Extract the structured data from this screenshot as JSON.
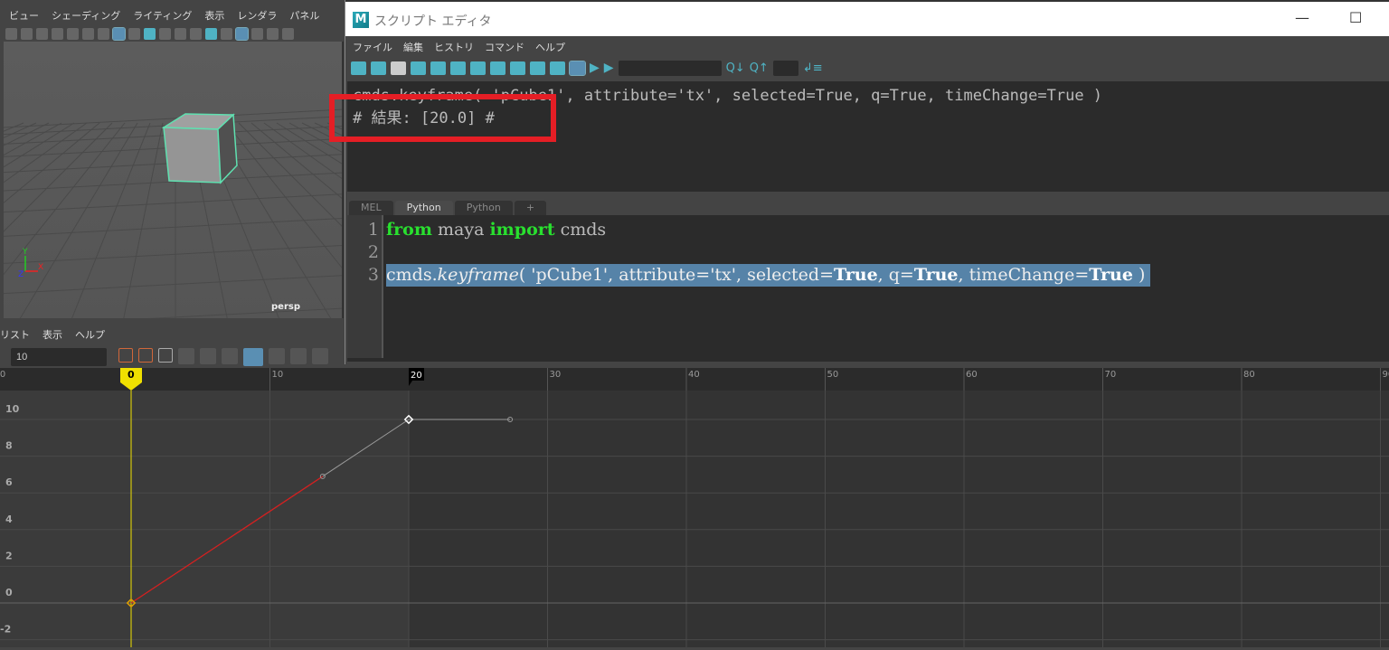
{
  "main_menu": [
    "ビュー",
    "シェーディング",
    "ライティング",
    "表示",
    "レンダラ",
    "パネル"
  ],
  "viewport": {
    "camera_label": "persp",
    "axis_labels": {
      "x": "X",
      "y": "Y",
      "z": "Z"
    },
    "selected_object": "pCube1"
  },
  "graph_editor": {
    "menu": [
      "リスト",
      "表示",
      "ヘルプ"
    ],
    "frame_field_value": "10",
    "ruler_ticks": [
      "10",
      "0",
      "10",
      "20",
      "30",
      "40",
      "50",
      "60",
      "70",
      "80",
      "90"
    ],
    "current_frame": "0",
    "marked_frame": "20",
    "value_ticks": [
      "10",
      "8",
      "6",
      "4",
      "2",
      "0",
      "-2"
    ],
    "curve": {
      "attribute": "tx",
      "keys": [
        {
          "frame": 0,
          "value": 0
        },
        {
          "frame": 20,
          "value": 10
        }
      ],
      "color_selected_segment": "#d42020",
      "color_curve": "#9a9a9a",
      "current_time_color": "#f0e000"
    }
  },
  "script_editor": {
    "title": "スクリプト エディタ",
    "logo": "M",
    "menu": [
      "ファイル",
      "編集",
      "ヒストリ",
      "コマンド",
      "ヘルプ"
    ],
    "output_lines": [
      "cmds.keyframe( 'pCube1', attribute='tx', selected=True, q=True, timeChange=True )",
      "# 結果: [20.0] #"
    ],
    "tabs": [
      "MEL",
      "Python",
      "Python",
      "+"
    ],
    "active_tab": "Python",
    "line_numbers": [
      "1",
      "2",
      "3"
    ],
    "code": {
      "l1": {
        "kw1": "from",
        "mod": " maya ",
        "kw2": "import",
        "rest": " cmds"
      },
      "l3": {
        "pre": "cmds.",
        "fn": "keyframe",
        "args1": "( 'pCube1', attribute='tx', selected=",
        "t1": "True",
        "args2": ", q=",
        "t2": "True",
        "args3": ", timeChange=",
        "t3": "True",
        "end": " )"
      }
    },
    "highlight_color": "#e51e25"
  }
}
